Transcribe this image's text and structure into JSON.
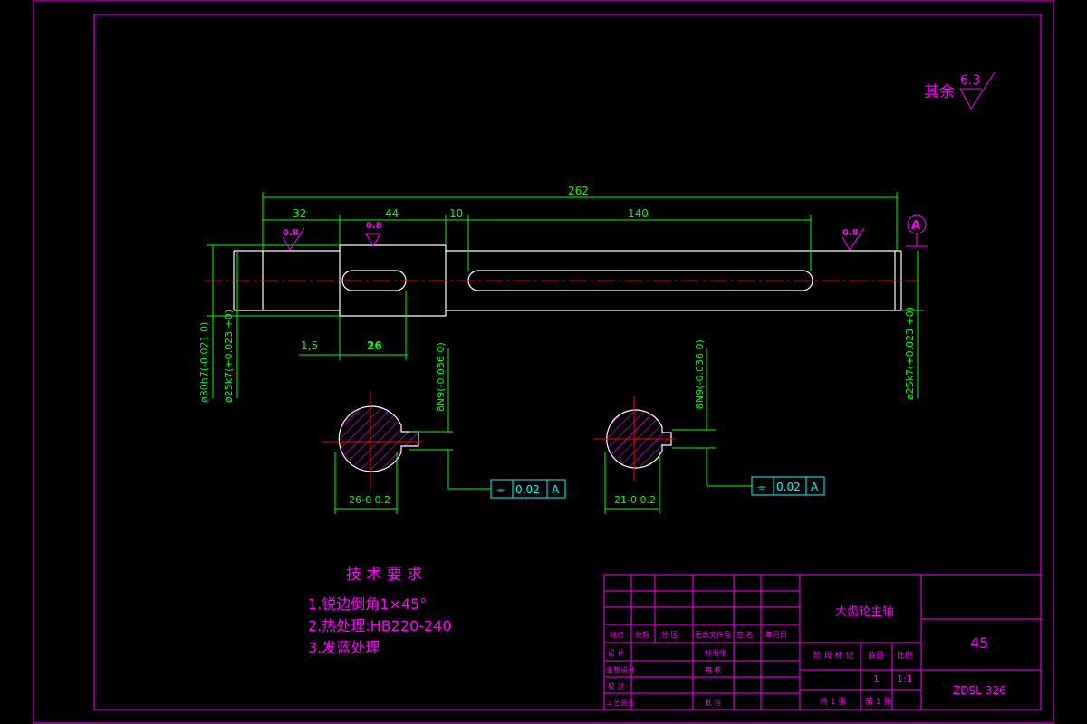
{
  "roughness_note": {
    "prefix": "其余",
    "value": "6.3"
  },
  "datum_label": "A",
  "dimensions": {
    "overall_length": "262",
    "segment_1": "32",
    "segment_2": "44",
    "segment_3": "10",
    "segment_4": "140",
    "chamfer_offset": "1,5",
    "keyway_length": "26",
    "left_diameter": "ø30h7(-0.021 0)",
    "left_journal_diameter": "ø25k7(+0.023 +0)",
    "right_journal_diameter": "ø25k7(+0.023 +0)",
    "roughness_1": "0.8",
    "roughness_2": "0.8",
    "roughness_3": "0.8"
  },
  "section_left": {
    "keyway_width": "8N9(-0.036 0)",
    "depth": "26-0 0.2",
    "tolerance": {
      "symbol": "⌯",
      "value": "0.02",
      "datum": "A"
    }
  },
  "section_right": {
    "keyway_width": "8N9(-0.036 0)",
    "depth": "21-0 0.2",
    "tolerance": {
      "symbol": "⌯",
      "value": "0.02",
      "datum": "A"
    }
  },
  "tech_requirements": {
    "title": "技 术 要 求",
    "items": [
      "1.锐边倒角1×45°",
      "2.热处理:HB220-240",
      "3.发蓝处理"
    ]
  },
  "title_block": {
    "part_name": "大齿轮主轴",
    "material": "45",
    "drawing_no": "ZDSL-326",
    "quantity": "1",
    "scale": "1:1",
    "header_labels": [
      "标记",
      "处数",
      "分 区",
      "更改文件号",
      "签 名",
      "年月日"
    ],
    "row_labels": [
      "设 计",
      "主管设计",
      "校 对",
      "工艺会签"
    ],
    "standardize": "标准化",
    "review": "审 核",
    "approve": "批 准",
    "stage_mark": "阶 段 标 记",
    "weight": "数量",
    "ratio": "比例",
    "sheets_total": "共 1 张",
    "sheet_no": "第 1 张"
  },
  "colors": {
    "border": "#ff00ff",
    "dimension": "#00ff00",
    "outline": "#ffffff",
    "centerline": "#ff0000",
    "hatch": "#ff00ff",
    "tolerance": "#00ffff"
  }
}
